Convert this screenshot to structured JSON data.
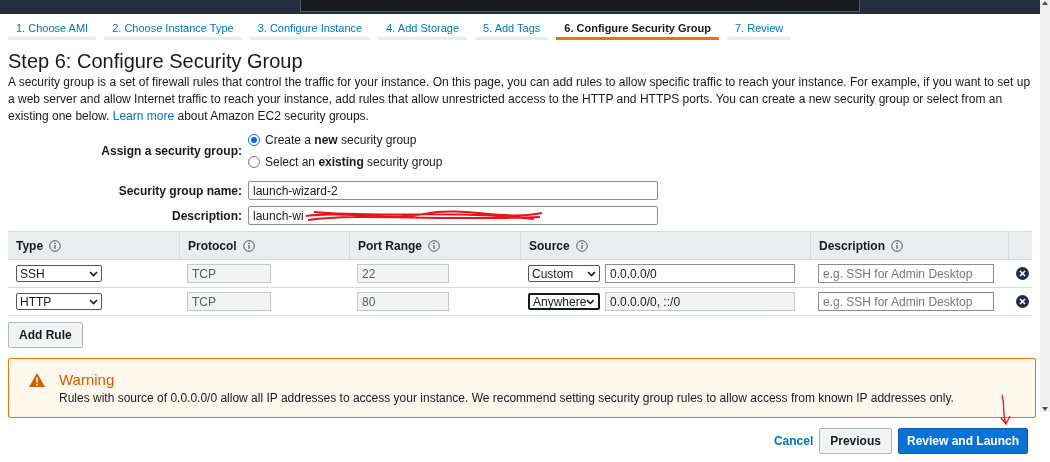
{
  "steps": [
    {
      "label": "1. Choose AMI",
      "selected": false
    },
    {
      "label": "2. Choose Instance Type",
      "selected": false
    },
    {
      "label": "3. Configure Instance",
      "selected": false
    },
    {
      "label": "4. Add Storage",
      "selected": false
    },
    {
      "label": "5. Add Tags",
      "selected": false
    },
    {
      "label": "6. Configure Security Group",
      "selected": true
    },
    {
      "label": "7. Review",
      "selected": false
    }
  ],
  "title": "Step 6: Configure Security Group",
  "intro": "A security group is a set of firewall rules that control the traffic for your instance. On this page, you can add rules to allow specific traffic to reach your instance. For example, if you want to set up a web server and allow Internet traffic to reach your instance, add rules that allow unrestricted access to the HTTP and HTTPS ports. You can create a new security group or select from an existing one below.",
  "intro_link": "Learn more",
  "intro_tail": "about Amazon EC2 security groups.",
  "assign": {
    "label": "Assign a security group:",
    "options": [
      {
        "text": "Create a **new** security group",
        "selected": true
      },
      {
        "text": "Select an **existing** security group",
        "selected": false
      }
    ]
  },
  "name_field": {
    "label": "Security group name:",
    "value": "launch-wizard-2"
  },
  "description_field": {
    "label": "Description:",
    "value": "launch-wi",
    "redacted": true
  },
  "columns": [
    "Type",
    "Protocol",
    "Port Range",
    "Source",
    "Description"
  ],
  "rules": [
    {
      "type": "SSH",
      "protocol": "TCP",
      "port_range": "22",
      "source": "Custom",
      "source_focused": false,
      "cidr": "0.0.0.0/0",
      "cidr_disabled": false,
      "description_placeholder": "e.g. SSH for Admin Desktop"
    },
    {
      "type": "HTTP",
      "protocol": "TCP",
      "port_range": "80",
      "source": "Anywhere",
      "source_focused": true,
      "cidr": "0.0.0.0/0, ::/0",
      "cidr_disabled": true,
      "description_placeholder": "e.g. SSH for Admin Desktop"
    }
  ],
  "add_rule": "Add Rule",
  "warning": {
    "title": "Warning",
    "text": "Rules with source of 0.0.0.0/0 allow all IP addresses to access your instance. We recommend setting security group rules to allow access from known IP addresses only."
  },
  "footer": {
    "cancel": "Cancel",
    "previous": "Previous",
    "next": "Review and Launch"
  }
}
